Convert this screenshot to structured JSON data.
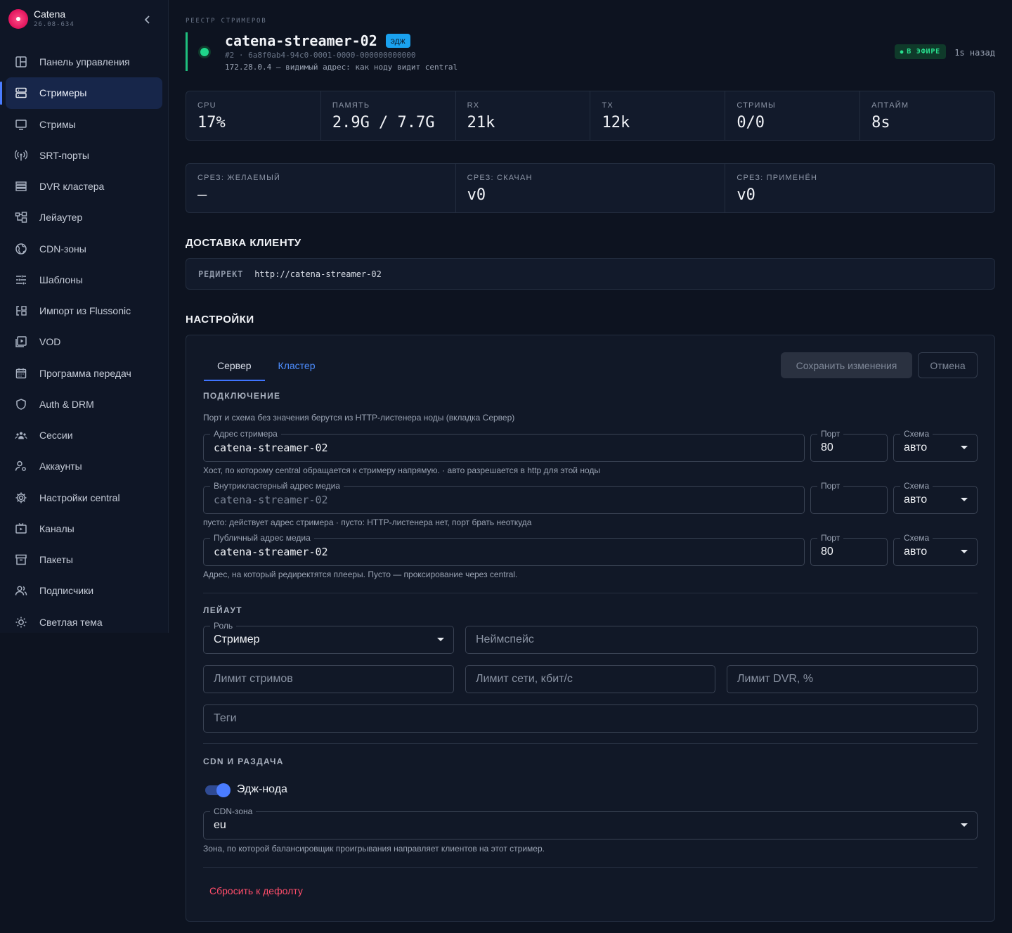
{
  "brand": {
    "name": "Catena",
    "version": "26.08-634"
  },
  "sidebar": {
    "items": [
      {
        "label": "Панель управления",
        "icon": "dashboard-icon"
      },
      {
        "label": "Стримеры",
        "icon": "server-icon",
        "active": true
      },
      {
        "label": "Стримы",
        "icon": "monitor-icon"
      },
      {
        "label": "SRT-порты",
        "icon": "antenna-icon"
      },
      {
        "label": "DVR кластера",
        "icon": "storage-icon"
      },
      {
        "label": "Лейаутер",
        "icon": "layout-icon"
      },
      {
        "label": "CDN-зоны",
        "icon": "globe-icon"
      },
      {
        "label": "Шаблоны",
        "icon": "sliders-icon"
      },
      {
        "label": "Импорт из Flussonic",
        "icon": "import-icon"
      },
      {
        "label": "VOD",
        "icon": "video-icon"
      },
      {
        "label": "Программа передач",
        "icon": "calendar-icon"
      },
      {
        "label": "Auth & DRM",
        "icon": "shield-icon"
      },
      {
        "label": "Сессии",
        "icon": "users-group-icon"
      },
      {
        "label": "Аккаунты",
        "icon": "user-gear-icon"
      },
      {
        "label": "Настройки central",
        "icon": "gear-icon"
      },
      {
        "label": "Каналы",
        "icon": "tv-icon"
      },
      {
        "label": "Пакеты",
        "icon": "archive-icon"
      },
      {
        "label": "Подписчики",
        "icon": "people-icon"
      },
      {
        "label": "Светлая тема",
        "icon": "sun-icon"
      }
    ]
  },
  "header": {
    "breadcrumb": "РЕЕСТР СТРИМЕРОВ",
    "node_name": "catena-streamer-02",
    "edge_badge": "эдж",
    "node_id": "#2 · 6a8f0ab4-94c0-0001-0000-000000000000",
    "node_addr": "172.28.0.4 — видимый адрес: как ноду видит central",
    "live_badge": "В ЭФИРЕ",
    "last_seen": "1s назад"
  },
  "stats": [
    {
      "label": "CPU",
      "value": "17%"
    },
    {
      "label": "ПАМЯТЬ",
      "value": "2.9G / 7.7G"
    },
    {
      "label": "RX",
      "value": "21k"
    },
    {
      "label": "TX",
      "value": "12k"
    },
    {
      "label": "СТРИМЫ",
      "value": "0/0"
    },
    {
      "label": "АПТАЙМ",
      "value": "8s"
    }
  ],
  "slices": [
    {
      "label": "СРЕЗ: ЖЕЛАЕМЫЙ",
      "value": "—"
    },
    {
      "label": "СРЕЗ: СКАЧАН",
      "value": "v0"
    },
    {
      "label": "СРЕЗ: ПРИМЕНЁН",
      "value": "v0"
    }
  ],
  "delivery": {
    "title": "ДОСТАВКА КЛИЕНТУ",
    "redirect_label": "РЕДИРЕКТ",
    "redirect_url": "http://catena-streamer-02"
  },
  "settings": {
    "title": "НАСТРОЙКИ",
    "tabs": [
      "Сервер",
      "Кластер"
    ],
    "save_label": "Сохранить изменения",
    "cancel_label": "Отмена",
    "connection": {
      "title": "ПОДКЛЮЧЕНИЕ",
      "hint": "Порт и схема без значения берутся из HTTP-листенера ноды (вкладка Сервер)",
      "rows": [
        {
          "addr_label": "Адрес стримера",
          "addr_value": "catena-streamer-02",
          "port_label": "Порт",
          "port_value": "80",
          "scheme_label": "Схема",
          "scheme_value": "авто",
          "hint": "Хост, по которому central обращается к стримеру напрямую. · авто разрешается в http для этой ноды"
        },
        {
          "addr_label": "Внутрикластерный адрес медиа",
          "addr_value": "catena-streamer-02",
          "port_label": "Порт",
          "port_value": "",
          "scheme_label": "Схема",
          "scheme_value": "авто",
          "hint": "пусто: действует адрес стримера · пусто: HTTP-листенера нет, порт брать неоткуда"
        },
        {
          "addr_label": "Публичный адрес медиа",
          "addr_value": "catena-streamer-02",
          "port_label": "Порт",
          "port_value": "80",
          "scheme_label": "Схема",
          "scheme_value": "авто",
          "hint": "Адрес, на который редиректятся плееры. Пусто — проксирование через central."
        }
      ]
    },
    "layout": {
      "title": "ЛЕЙАУТ",
      "role_label": "Роль",
      "role_value": "Стример",
      "namespace_placeholder": "Неймспейс",
      "streams_limit_placeholder": "Лимит стримов",
      "net_limit_placeholder": "Лимит сети, кбит/с",
      "dvr_limit_placeholder": "Лимит DVR, %",
      "tags_placeholder": "Теги"
    },
    "cdn": {
      "title": "CDN И РАЗДАЧА",
      "edge_toggle_label": "Эдж-нода",
      "edge_toggle_on": true,
      "zone_label": "CDN-зона",
      "zone_value": "eu",
      "zone_hint": "Зона, по которой балансировщик проигрывания направляет клиентов на этот стример."
    },
    "reset_label": "Сбросить к дефолту"
  },
  "colors": {
    "accent": "#4a7cff",
    "live": "#29e08f",
    "danger": "#ff4d6a",
    "edge_badge": "#1aa2f0"
  }
}
